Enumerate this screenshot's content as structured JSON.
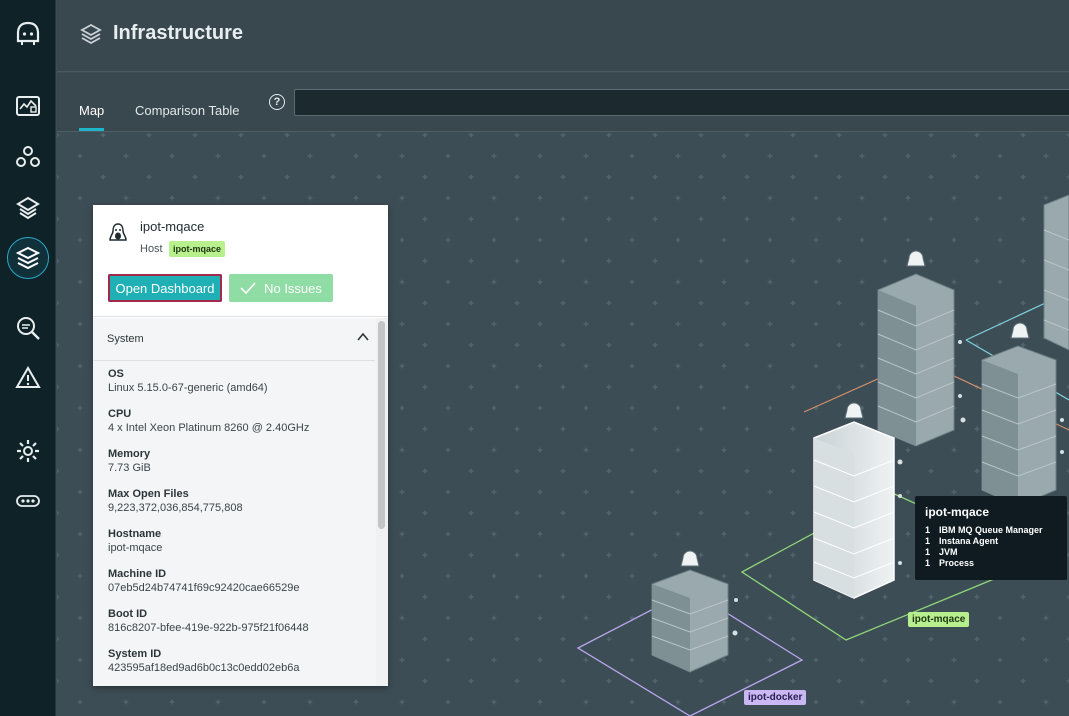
{
  "nav": {
    "items": [
      {
        "name": "home-logo-icon",
        "active": false
      },
      {
        "name": "dashboard-icon",
        "active": false
      },
      {
        "name": "applications-icon",
        "active": false
      },
      {
        "name": "platforms-icon",
        "active": false
      },
      {
        "name": "infrastructure-icon",
        "active": true
      },
      {
        "name": "analytics-icon",
        "active": false
      },
      {
        "name": "events-icon",
        "active": false
      },
      {
        "name": "settings-icon",
        "active": false
      },
      {
        "name": "more-icon",
        "active": false
      }
    ]
  },
  "header": {
    "title": "Infrastructure",
    "icon": "layers-icon"
  },
  "tabs": [
    {
      "label": "Map",
      "active": true
    },
    {
      "label": "Comparison Table",
      "active": false
    }
  ],
  "search": {
    "value": "",
    "placeholder": ""
  },
  "panel": {
    "host_name": "ipot-mqace",
    "host_type": "Host",
    "host_tag": "ipot-mqace",
    "open_dashboard": "Open Dashboard",
    "no_issues": "No Issues",
    "section_title": "System",
    "fields": [
      {
        "key": "OS",
        "value": "Linux 5.15.0-67-generic (amd64)"
      },
      {
        "key": "CPU",
        "value": "4 x Intel Xeon Platinum 8260 @ 2.40GHz"
      },
      {
        "key": "Memory",
        "value": "7.73 GiB"
      },
      {
        "key": "Max Open Files",
        "value": "9,223,372,036,854,775,808"
      },
      {
        "key": "Hostname",
        "value": "ipot-mqace"
      },
      {
        "key": "Machine ID",
        "value": "07eb5d24b74741f69c92420cae66529e"
      },
      {
        "key": "Boot ID",
        "value": "816c8207-bfee-419e-922b-975f21f06448"
      },
      {
        "key": "System ID",
        "value": "423595af18ed9ad6b0c13c0edd02eb6a"
      }
    ]
  },
  "tooltip": {
    "title": "ipot-mqace",
    "rows": [
      {
        "count": "1",
        "label": "IBM MQ Queue Manager"
      },
      {
        "count": "1",
        "label": "Instana Agent"
      },
      {
        "count": "1",
        "label": "JVM"
      },
      {
        "count": "1",
        "label": "Process"
      }
    ]
  },
  "zones": [
    {
      "label": "ipot-mqace",
      "color": "#b7ef8f"
    },
    {
      "label": "ipot-docker",
      "color": "#c9b8f3"
    }
  ],
  "colors": {
    "rail_bg": "#0f2228",
    "header_bg": "#39474e",
    "map_bg": "#3d4d55",
    "accent": "#1fb4c9",
    "dashboard_button": "#1fb0b6",
    "no_issues_button": "#8fdca5",
    "zone_green": "#8fd67a",
    "zone_purple": "#b9a7ee",
    "zone_orange": "#d0906a",
    "zone_cyan": "#7ed3df"
  }
}
